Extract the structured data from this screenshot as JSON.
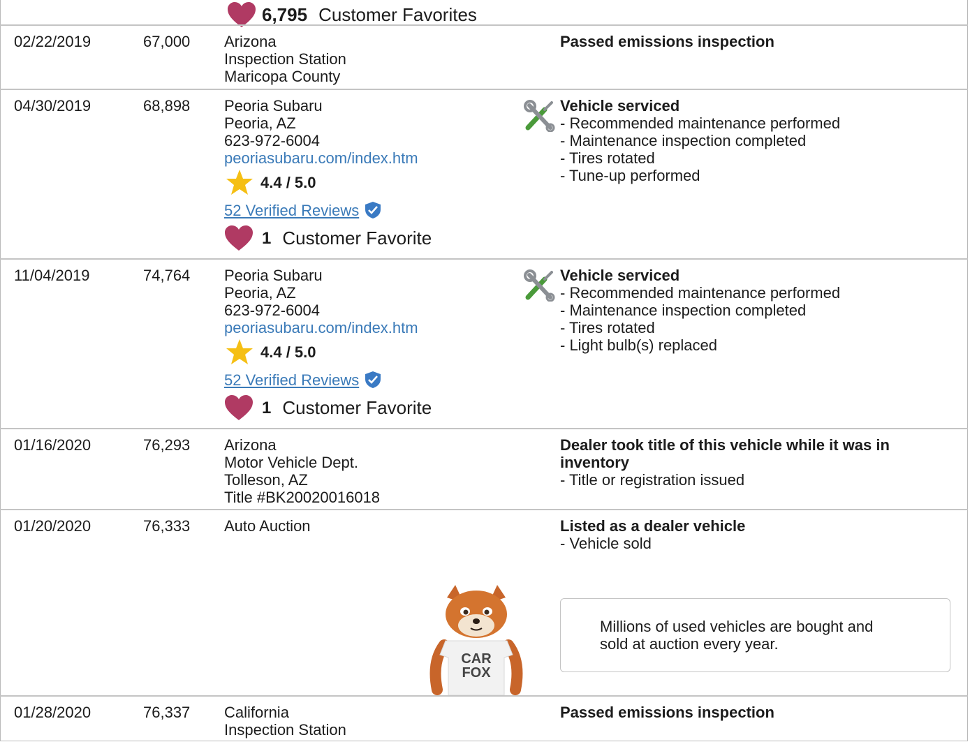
{
  "top_favorites": {
    "count": "6,795",
    "label": "Customer Favorites"
  },
  "records": [
    {
      "date": "02/22/2019",
      "odometer": "67,000",
      "source": [
        "Arizona",
        "Inspection Station",
        "Maricopa County"
      ],
      "title": "Passed emissions inspection",
      "details": []
    },
    {
      "date": "04/30/2019",
      "odometer": "68,898",
      "source": [
        "Peoria Subaru",
        "Peoria, AZ",
        "623-972-6004"
      ],
      "link": "peoriasubaru.com/index.htm",
      "rating": "4.4 / 5.0",
      "reviews": "52 Verified Reviews",
      "favorite_count": "1",
      "favorite_label": "Customer Favorite",
      "title": "Vehicle serviced",
      "details": [
        "- Recommended maintenance performed",
        "- Maintenance inspection completed",
        "- Tires rotated",
        "- Tune-up performed"
      ]
    },
    {
      "date": "11/04/2019",
      "odometer": "74,764",
      "source": [
        "Peoria Subaru",
        "Peoria, AZ",
        "623-972-6004"
      ],
      "link": "peoriasubaru.com/index.htm",
      "rating": "4.4 / 5.0",
      "reviews": "52 Verified Reviews",
      "favorite_count": "1",
      "favorite_label": "Customer Favorite",
      "title": "Vehicle serviced",
      "details": [
        "- Recommended maintenance performed",
        "- Maintenance inspection completed",
        "- Tires rotated",
        "- Light bulb(s) replaced"
      ]
    },
    {
      "date": "01/16/2020",
      "odometer": "76,293",
      "source": [
        "Arizona",
        "Motor Vehicle Dept.",
        "Tolleson, AZ",
        "Title #BK20020016018"
      ],
      "title": [
        "Dealer took title of this vehicle while it was in",
        "inventory"
      ],
      "details": [
        "- Title or registration issued"
      ]
    },
    {
      "date": "01/20/2020",
      "odometer": "76,333",
      "source": [
        "Auto Auction"
      ],
      "title": "Listed as a dealer vehicle",
      "details": [
        "- Vehicle sold"
      ],
      "tip": [
        "Millions of used vehicles are bought and",
        "sold at auction every year."
      ],
      "mascot_shirt": [
        "CAR",
        "FOX"
      ]
    },
    {
      "date": "01/28/2020",
      "odometer": "76,337",
      "source": [
        "California",
        "Inspection Station"
      ],
      "title": "Passed emissions inspection",
      "details": []
    }
  ],
  "icons": {
    "heart": "heart-icon",
    "star": "star-icon",
    "verified": "verified-shield-icon",
    "tools": "wrench-screwdriver-icon",
    "mascot": "carfox-mascot"
  },
  "colors": {
    "link": "#3a7ab8",
    "heart": "#b03a63",
    "star": "#f5bf14",
    "verified": "#3a7ac4",
    "border": "#c4c4c4"
  }
}
